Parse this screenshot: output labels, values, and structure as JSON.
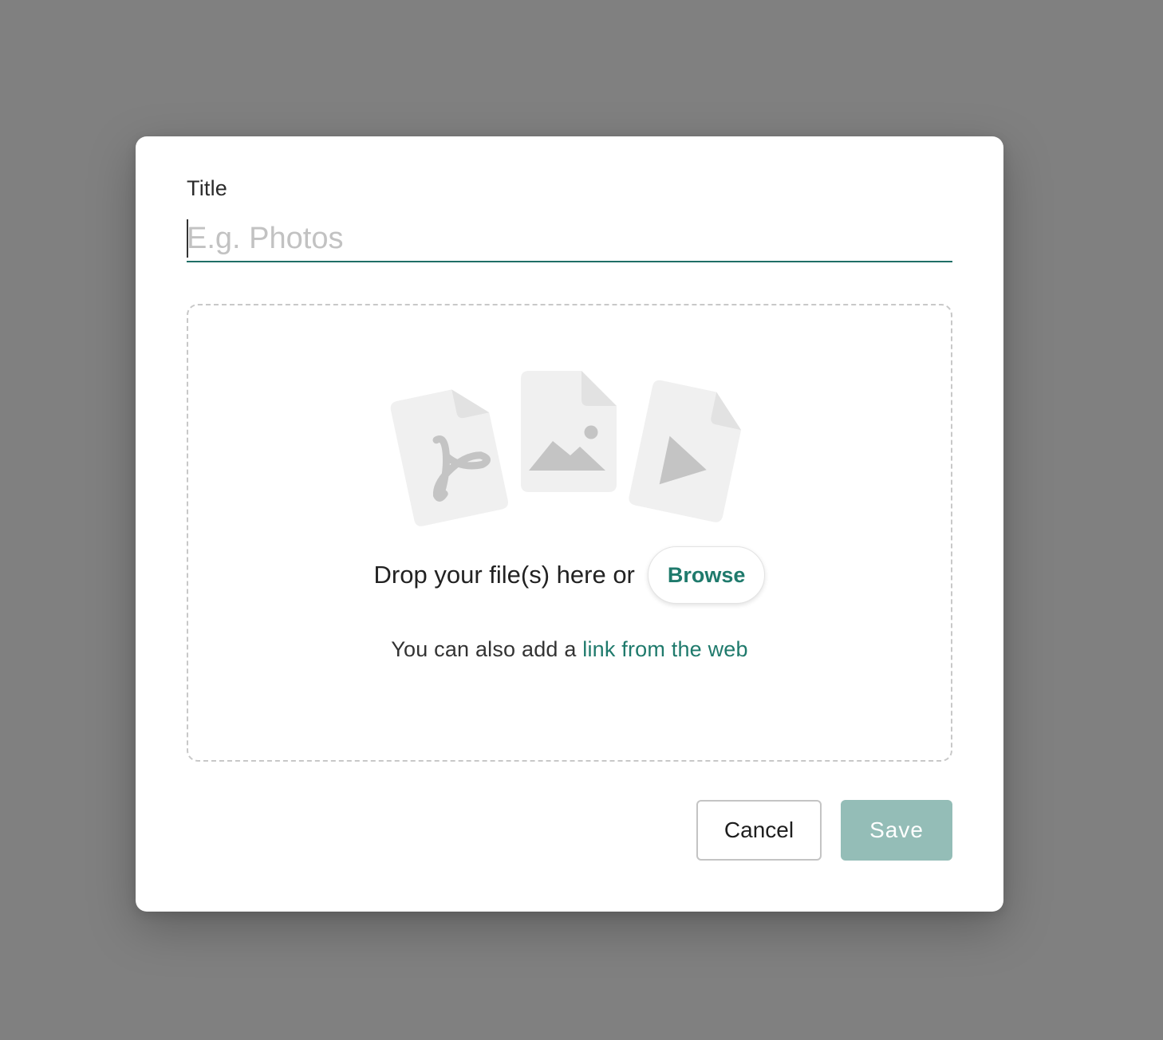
{
  "modal": {
    "title_label": "Title",
    "title_input": {
      "value": "",
      "placeholder": "E.g. Photos"
    },
    "dropzone": {
      "icons": [
        "pdf-file-icon",
        "image-file-icon",
        "video-file-icon"
      ],
      "drop_text": "Drop your file(s) here or",
      "browse_label": "Browse",
      "also_text": "You can also add a",
      "link_text": "link from the web"
    },
    "actions": {
      "cancel_label": "Cancel",
      "save_label": "Save",
      "save_disabled": true
    }
  },
  "colors": {
    "accent": "#1f7a6c",
    "input_underline": "#1f6f66",
    "save_disabled_bg": "#94bdb7",
    "overlay": "#808080",
    "icon_fill": "#f0f0f0",
    "icon_glyph": "#c4c4c4"
  }
}
